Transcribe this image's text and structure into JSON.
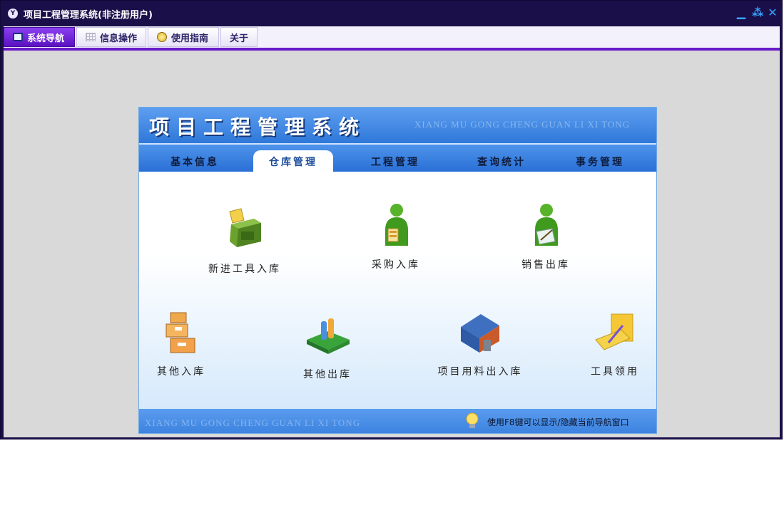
{
  "window": {
    "title": "项目工程管理系统(非注册用户)",
    "controls": [
      "minimize-icon",
      "restore-icon",
      "close-icon"
    ]
  },
  "toolbar": {
    "tabs": [
      {
        "label": "系统导航",
        "icon": "monitor-icon",
        "active": true
      },
      {
        "label": "信息操作",
        "icon": "grid-icon",
        "active": false
      },
      {
        "label": "使用指南",
        "icon": "clock-icon",
        "active": false
      },
      {
        "label": "关于",
        "icon": "",
        "active": false
      }
    ]
  },
  "panel": {
    "title": "项目工程管理系统",
    "subtitle": "XIANG MU GONG CHENG GUAN LI XI TONG",
    "tabs": [
      {
        "label": "基本信息",
        "active": false
      },
      {
        "label": "仓库管理",
        "active": true
      },
      {
        "label": "工程管理",
        "active": false
      },
      {
        "label": "查询统计",
        "active": false
      },
      {
        "label": "事务管理",
        "active": false
      }
    ],
    "items": [
      {
        "label": "新进工具入库",
        "icon": "new-tools-stock-icon"
      },
      {
        "label": "采购入库",
        "icon": "purchase-stock-icon"
      },
      {
        "label": "销售出库",
        "icon": "sales-out-icon"
      },
      {
        "label": "其他入库",
        "icon": "other-in-icon"
      },
      {
        "label": "其他出库",
        "icon": "other-out-icon"
      },
      {
        "label": "项目用料出入库",
        "icon": "project-material-icon"
      },
      {
        "label": "工具领用",
        "icon": "tool-collection-icon"
      }
    ],
    "footer": {
      "subtitle": "XIANG MU GONG CHENG GUAN LI XI TONG",
      "tip": "使用F8键可以显示/隐藏当前导航窗口"
    }
  },
  "colors": {
    "title_bar": "#1b0f4a",
    "accent": "#6a1bc9",
    "panel_blue": "#2f78d9"
  }
}
